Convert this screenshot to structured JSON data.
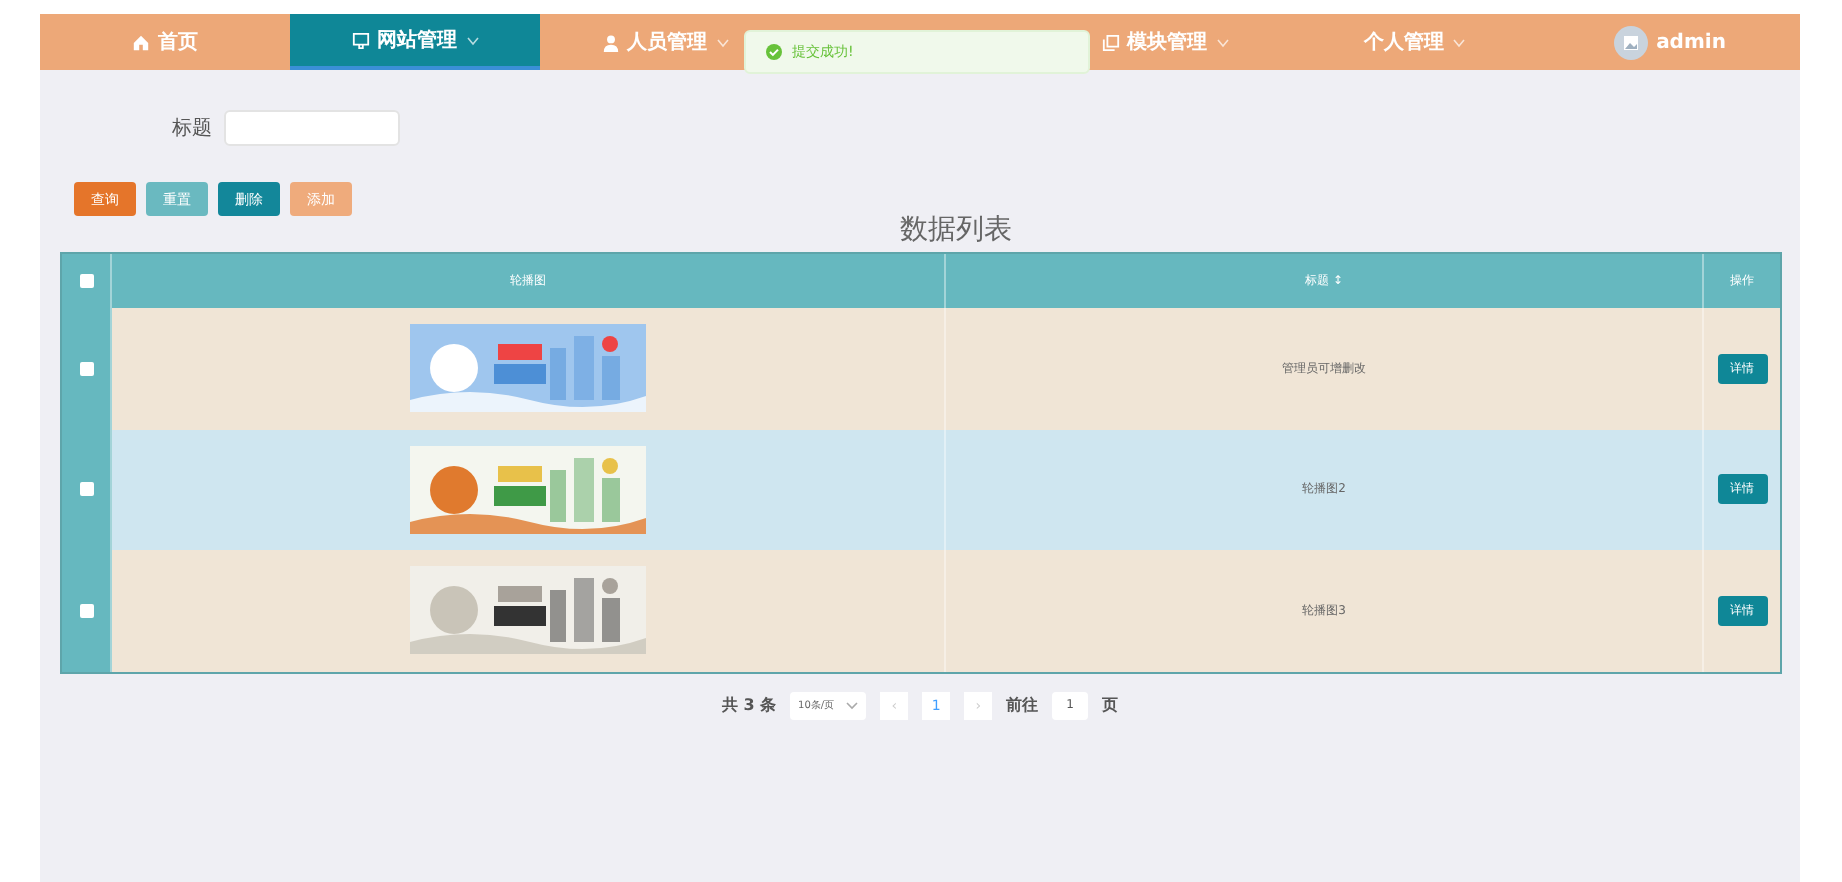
{
  "nav": {
    "items": [
      {
        "label": "首页",
        "selected": false,
        "caret": false
      },
      {
        "label": "网站管理",
        "selected": true,
        "caret": true
      },
      {
        "label": "人员管理",
        "selected": false,
        "caret": true
      },
      {
        "label": "模块管理",
        "selected": false,
        "caret": true
      },
      {
        "label": "个人管理",
        "selected": false,
        "caret": true
      }
    ],
    "user": {
      "name": "admin"
    }
  },
  "toast": {
    "text": "提交成功!"
  },
  "search": {
    "label": "标题"
  },
  "buttons": [
    {
      "label": "查询",
      "color": "#e5752a"
    },
    {
      "label": "重置",
      "color": "#6ab9c0"
    },
    {
      "label": "删除",
      "color": "#13879a"
    },
    {
      "label": "添加",
      "color": "#efab7c"
    }
  ],
  "table": {
    "title": "数据列表",
    "select_all_checked": false,
    "columns": [
      "轮播图",
      "标题 ↕",
      "操作"
    ],
    "rows": [
      {
        "checked": false,
        "title": "管理员可增删改",
        "action": "详情",
        "color": "#f0e5d6"
      },
      {
        "checked": false,
        "title": "轮播图2",
        "action": "详情",
        "color": "#cfe6f0"
      },
      {
        "checked": false,
        "title": "轮播图3",
        "action": "详情",
        "color": "#f0e5d6"
      }
    ]
  },
  "pagination": {
    "total": "共 3 条",
    "page_size": "10条/页",
    "prev": "‹",
    "page": "1",
    "next": "›",
    "goto_label": "前往",
    "goto_value": "1",
    "goto_suffix": "页"
  }
}
